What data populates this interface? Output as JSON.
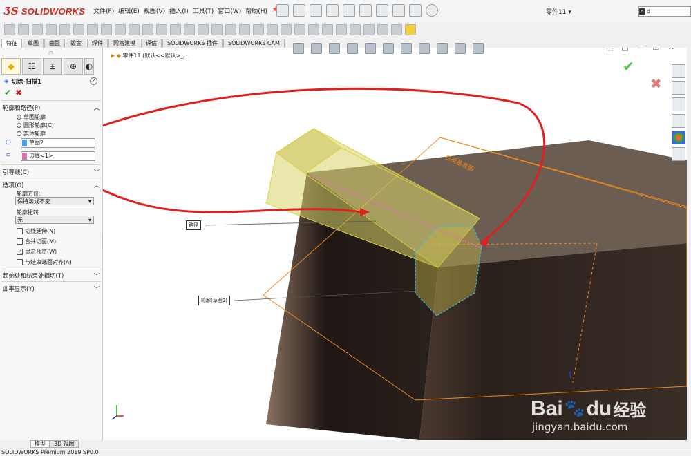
{
  "app": {
    "brand": "SOLIDWORKS",
    "doc_title": "零件11",
    "search_text": "d"
  },
  "menus": [
    "文件(F)",
    "编辑(E)",
    "视图(V)",
    "插入(I)",
    "工具(T)",
    "窗口(W)",
    "帮助(H)"
  ],
  "tabs": [
    "特征",
    "草图",
    "曲面",
    "钣金",
    "焊件",
    "网格建模",
    "评估",
    "SOLIDWORKS 插件",
    "SOLIDWORKS CAM"
  ],
  "tabs_active": 0,
  "breadcrumb": "零件11 (默认<<默认>_...",
  "feature": {
    "title": "切除-扫描1",
    "section_profile": "轮廓和路径(P)",
    "radios": [
      {
        "label": "草图轮廓",
        "checked": true
      },
      {
        "label": "圆形轮廓(C)",
        "checked": false
      },
      {
        "label": "实体轮廓",
        "checked": false
      }
    ],
    "profile_value": "草图2",
    "path_value": "边线<1>",
    "section_guides": "引导线(C)",
    "section_options": "选项(O)",
    "orientation_label": "轮廓方位:",
    "orientation_value": "保持法线不变",
    "twist_label": "轮廓扭转",
    "twist_value": "无",
    "checkboxes": [
      {
        "label": "切线延伸(N)",
        "checked": false
      },
      {
        "label": "合并切面(M)",
        "checked": false
      },
      {
        "label": "显示预览(W)",
        "checked": true
      },
      {
        "label": "与结束端面对齐(A)",
        "checked": false
      }
    ],
    "section_start_end": "起始处和结束处相切(T)",
    "section_curvature": "曲率显示(Y)"
  },
  "viewport": {
    "callout_path": "路径",
    "callout_profile": "轮廓(草图2)",
    "plane_label": "右视基准面"
  },
  "bottom_tabs": [
    "模型",
    "3D 视图"
  ],
  "status": "SOLIDWORKS Premium 2019 SP0.0",
  "watermark": {
    "brand": "Bai",
    "paw": "du",
    "chinese": "经验",
    "url": "jingyan.baidu.com"
  },
  "colors": {
    "brand_red": "#d9261c",
    "annotation_red": "#e02020",
    "highlight_yellow": "#e8e24a",
    "plane_orange": "#f08a1c",
    "profile_cyan": "#39b9e6"
  },
  "icons": [
    "home-icon",
    "new-doc-icon",
    "open-icon",
    "save-icon",
    "print-icon",
    "undo-icon",
    "select-icon",
    "options-icon",
    "pin-icon"
  ]
}
